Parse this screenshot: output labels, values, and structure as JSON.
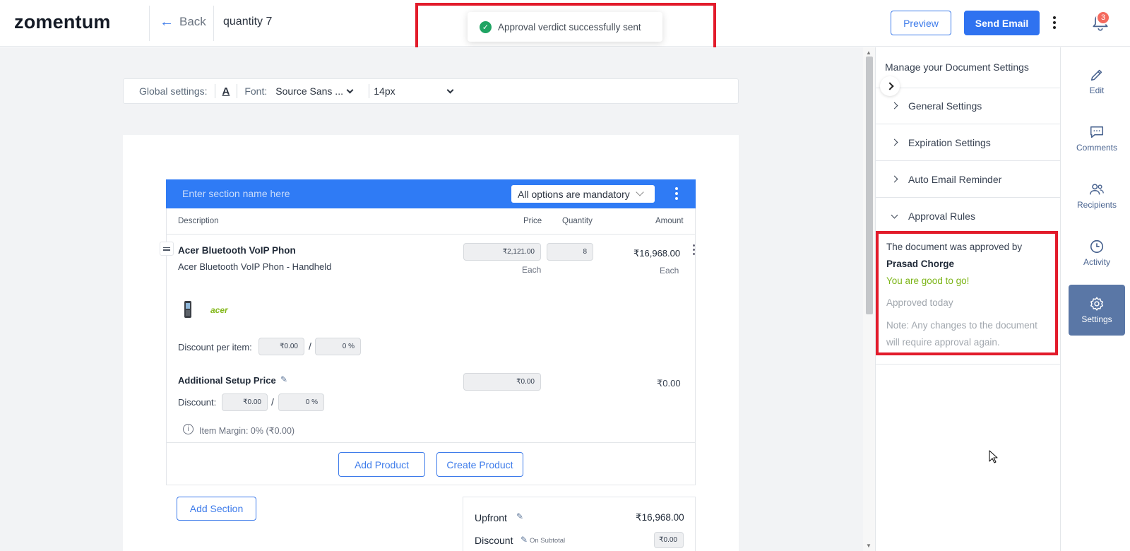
{
  "header": {
    "logo_text": "zomentum",
    "back_label": "Back",
    "doc_title": "quantity 7",
    "preview_label": "Preview",
    "send_email_label": "Send Email",
    "notification_count": "3"
  },
  "toast": {
    "message": "Approval verdict successfully sent"
  },
  "global_settings": {
    "label": "Global settings:",
    "text_color_glyph": "A",
    "font_label": "Font:",
    "font_value": "Source Sans ...",
    "size_value": "14px"
  },
  "section": {
    "name_placeholder": "Enter section name here",
    "options_mode": "All options are mandatory",
    "columns": {
      "description": "Description",
      "price": "Price",
      "quantity": "Quantity",
      "amount": "Amount"
    },
    "product": {
      "name": "Acer Bluetooth VoIP Phon",
      "description": "Acer Bluetooth VoIP Phon - Handheld",
      "brand": "acer",
      "price": "₹2,121.00",
      "price_unit": "Each",
      "quantity": "8",
      "amount": "₹16,968.00",
      "amount_unit": "Each",
      "discount_label": "Discount per item:",
      "discount_value": "₹0.00",
      "discount_pct": "0 %",
      "slash": "/"
    },
    "setup": {
      "name": "Additional Setup Price",
      "price": "₹0.00",
      "amount": "₹0.00",
      "discount_label": "Discount:",
      "discount_value": "₹0.00",
      "discount_pct": "0 %",
      "slash": "/"
    },
    "margin_text": "Item Margin: 0% (₹0.00)",
    "add_product_label": "Add Product",
    "create_product_label": "Create Product"
  },
  "add_section_label": "Add Section",
  "summary": {
    "upfront_label": "Upfront",
    "upfront_value": "₹16,968.00",
    "discount_label": "Discount",
    "discount_note": "On Subtotal",
    "discount_value": "₹0.00"
  },
  "settings_panel": {
    "title": "Manage your Document Settings",
    "items": [
      {
        "label": "General Settings"
      },
      {
        "label": "Expiration Settings"
      },
      {
        "label": "Auto Email Reminder"
      },
      {
        "label": "Approval Rules"
      }
    ],
    "approval": {
      "approved_by_text": "The document was approved by",
      "approver": "Prasad Chorge",
      "good_to_go": "You are good to go!",
      "when": "Approved today",
      "note": "Note: Any changes to the document will require approval again."
    }
  },
  "rail": {
    "items": [
      {
        "label": "Edit"
      },
      {
        "label": "Comments"
      },
      {
        "label": "Recipients"
      },
      {
        "label": "Activity"
      },
      {
        "label": "Settings"
      }
    ]
  },
  "colors": {
    "primary": "#2f72f0",
    "section_header": "#2f7bf5",
    "success_green": "#7cb518",
    "highlight_red": "#e21b2b",
    "rail_active": "#5a77a6"
  }
}
